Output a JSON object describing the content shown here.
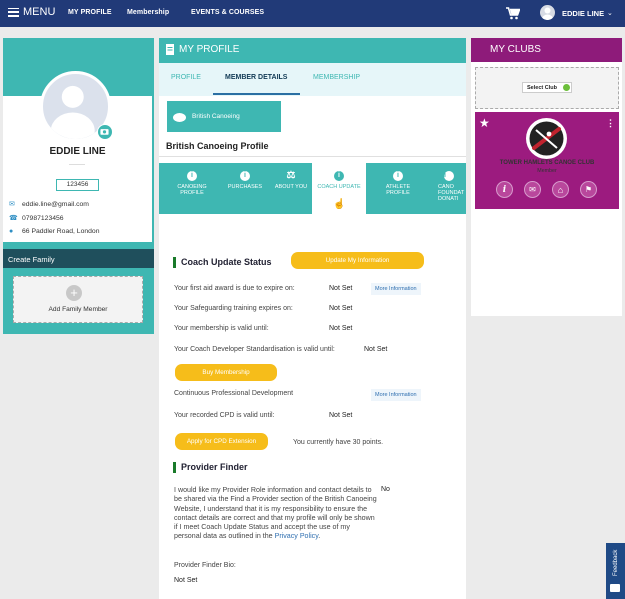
{
  "topnav": {
    "menu_label": "MENU",
    "links": [
      "MY PROFILE",
      "Membership",
      "EVENTS & COURSES"
    ],
    "user_name": "EDDIE LINE"
  },
  "profile": {
    "name": "EDDIE LINE",
    "member_id": "123456",
    "email": "eddie.line@gmail.com",
    "phone": "07987123456",
    "address": "66 Paddler Road, London"
  },
  "family": {
    "header": "Create Family",
    "add_label": "Add Family Member"
  },
  "my_profile": {
    "title": "MY PROFILE",
    "tabs": [
      "PROFILE",
      "MEMBER DETAILS",
      "MEMBERSHIP"
    ],
    "bc_button": "British Canoeing",
    "bc_title": "British Canoeing Profile",
    "icon_tabs": [
      {
        "line1": "CANOEING",
        "line2": "PROFILE"
      },
      {
        "line1": "PURCHASES",
        "line2": ""
      },
      {
        "line1": "ABOUT YOU",
        "line2": ""
      },
      {
        "line1": "COACH UPDATE",
        "line2": ""
      },
      {
        "line1": "ATHLETE",
        "line2": "PROFILE"
      },
      {
        "line1": "CANO",
        "line2": "FOUNDAT"
      },
      {
        "line1": "",
        "line2": "DONATI"
      }
    ]
  },
  "coach": {
    "title": "Coach Update Status",
    "update_btn": "Update My Information",
    "rows": [
      {
        "label": "Your first aid award is due to expire on:",
        "value": "Not Set",
        "more": "More Information"
      },
      {
        "label": "Your Safeguarding training expires on:",
        "value": "Not Set"
      },
      {
        "label": "Your membership is valid until:",
        "value": "Not Set"
      },
      {
        "label": "Your Coach Developer Standardisation is valid until:",
        "value": "Not Set"
      }
    ],
    "buy_btn": "Buy Membership",
    "cpd_label": "Continuous Professional Development",
    "cpd_more": "More Information",
    "cpd_valid_label": "Your recorded CPD is valid until:",
    "cpd_valid_value": "Not Set",
    "cpd_btn": "Apply for CPD Extension",
    "points": "You currently have 30 points."
  },
  "provider": {
    "title": "Provider Finder",
    "text": "I would like my Provider Role information and contact details to be shared via the Find a Provider section of the British Canoeing Website, I understand that it is my responsibility to ensure the contact details are correct and that my profile will only be shown if I meet Coach Update Status and accept the use of my personal data as outlined in the",
    "link": "Privacy Policy",
    "after_link": ".",
    "answer": "No",
    "bio_label": "Provider Finder Bio:",
    "bio_value": "Not Set"
  },
  "clubs": {
    "title": "MY CLUBS",
    "select_label": "Select Club",
    "club_name": "TOWER HAMLETS CANOE CLUB",
    "club_role": "Member",
    "icons": [
      "info-icon",
      "mail-icon",
      "home-icon",
      "map-icon"
    ]
  },
  "feedback": "Feedback",
  "colors": {
    "nav": "#213a78",
    "teal": "#3eb7b2",
    "club": "#9c1b7f",
    "yellow": "#f6bd1a"
  }
}
